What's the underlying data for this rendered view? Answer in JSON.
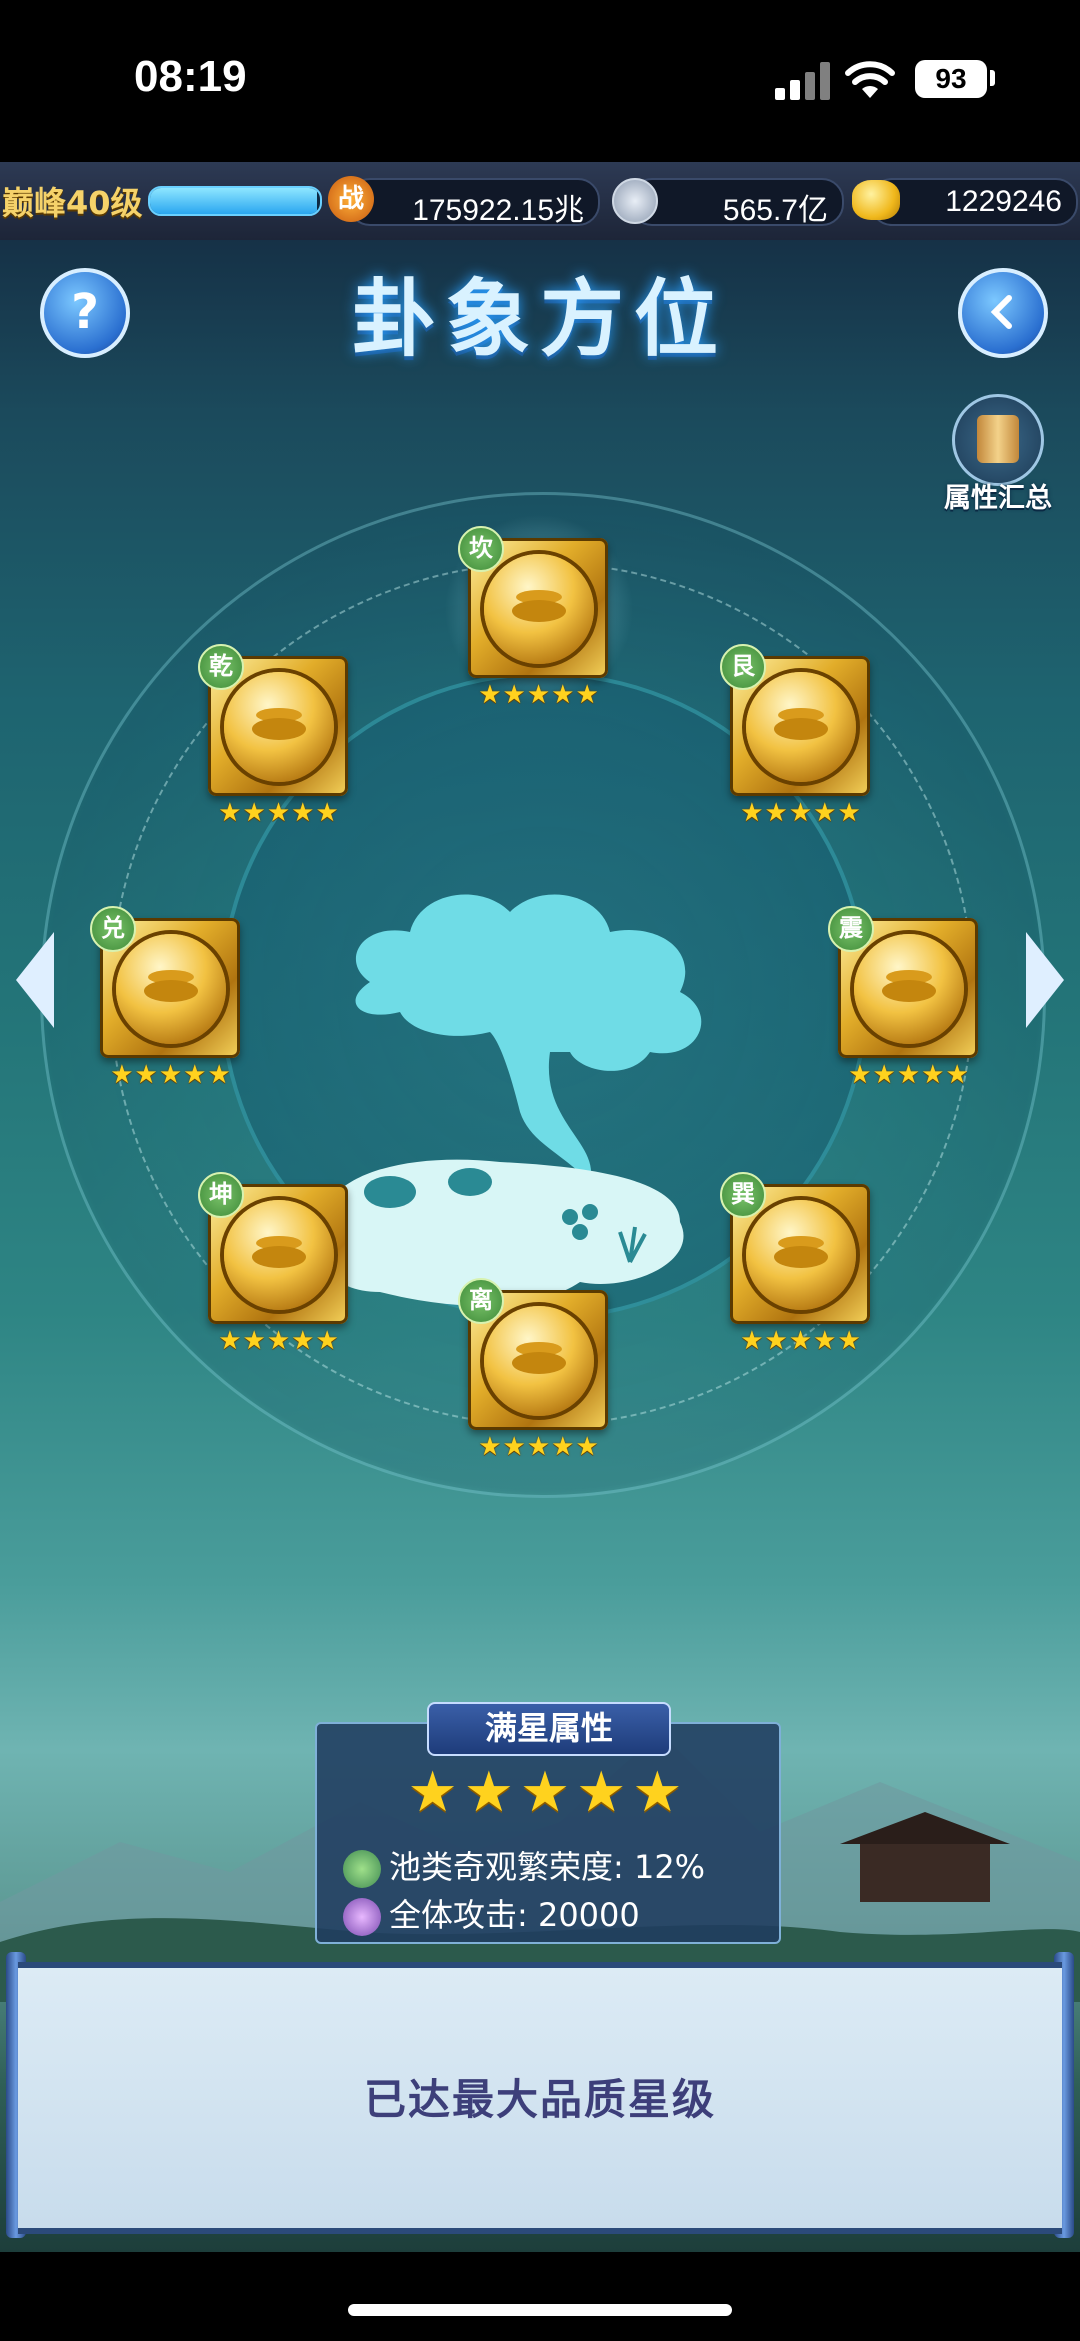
{
  "status_bar": {
    "time": "08:19",
    "battery": "93"
  },
  "top_bar": {
    "level": "巅峰40级",
    "xp_progress": 0.98,
    "power_icon": "战",
    "power": "175922.15兆",
    "silver": "565.7亿",
    "gold": "1229246"
  },
  "header": {
    "title": "卦象方位",
    "help_label": "?",
    "summary_label": "属性汇总"
  },
  "nodes": [
    {
      "name": "坎",
      "stars": "★★★★★"
    },
    {
      "name": "乾",
      "stars": "★★★★★"
    },
    {
      "name": "艮",
      "stars": "★★★★★"
    },
    {
      "name": "兑",
      "stars": "★★★★★"
    },
    {
      "name": "震",
      "stars": "★★★★★"
    },
    {
      "name": "坤",
      "stars": "★★★★★"
    },
    {
      "name": "巽",
      "stars": "★★★★★"
    },
    {
      "name": "离",
      "stars": "★★★★★"
    }
  ],
  "panel": {
    "title": "满星属性",
    "stars": "★★★★★",
    "attr1": "池类奇观繁荣度: 12%",
    "attr2": "全体攻击: 20000"
  },
  "bottom": {
    "message": "已达最大品质星级"
  },
  "colors": {
    "star": "#ffd21e",
    "badge": "#5aa84a",
    "title_glow": "#2aa0ff"
  }
}
